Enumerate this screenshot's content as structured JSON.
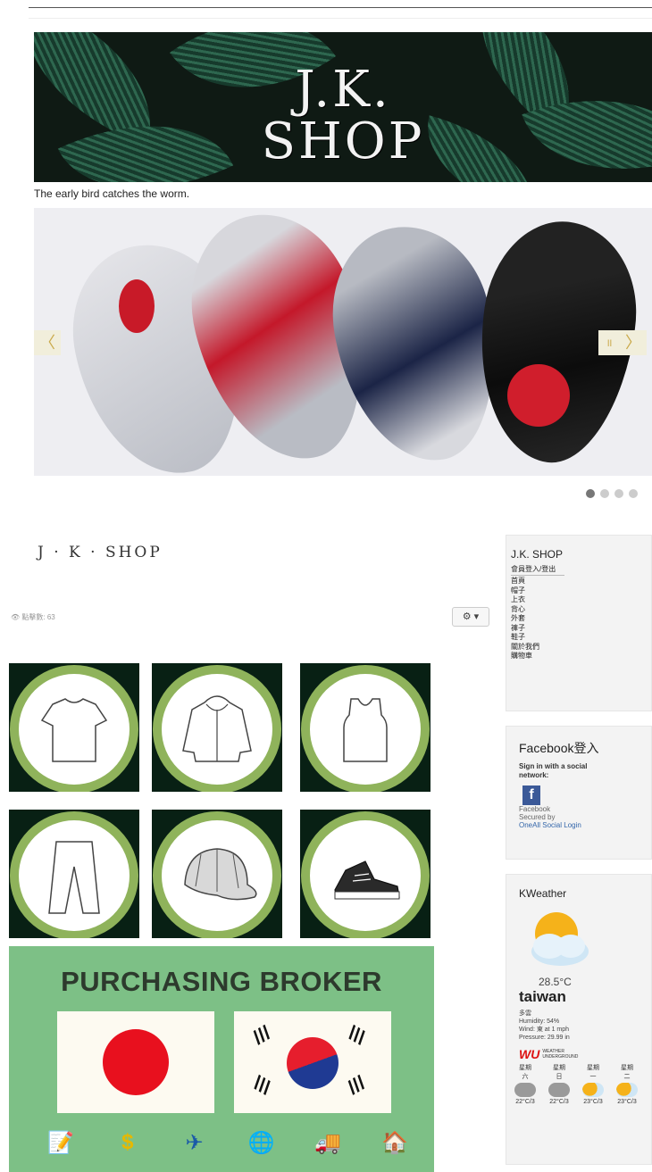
{
  "banner": {
    "title_line1": "J.K.",
    "title_line2": "SHOP"
  },
  "tagline": "The early bird catches the worm.",
  "slider": {
    "prev_label": "〈",
    "pause_label": "॥",
    "next_label": "〉",
    "slide_count": 4,
    "active_slide": 1
  },
  "site": {
    "name": "J · K · SHOP",
    "hits": "點擊數: 63",
    "gear_label": "⚙ ▾"
  },
  "categories": [
    {
      "name": "T-shirt",
      "icon": "tshirt-icon"
    },
    {
      "name": "Hoodie",
      "icon": "hoodie-icon"
    },
    {
      "name": "Vest",
      "icon": "vest-icon"
    },
    {
      "name": "Pants",
      "icon": "pants-icon"
    },
    {
      "name": "Hat",
      "icon": "hat-icon"
    },
    {
      "name": "Shoes",
      "icon": "sneaker-icon"
    }
  ],
  "broker": {
    "title": "PURCHASING BROKER",
    "icons": [
      "📝",
      "$",
      "✈",
      "🌐",
      "🚚",
      "🏠"
    ]
  },
  "sidebar": {
    "menu_title": "J.K. SHOP",
    "login": "會員登入/登出",
    "items": [
      "首頁",
      "帽子",
      "上衣",
      "背心",
      "外套",
      "褲子",
      "鞋子",
      "關於我們",
      "購物車"
    ],
    "facebook": {
      "title": "Facebook登入",
      "signin": "Sign in with a social network:",
      "icon_letter": "f",
      "icon_label": "Facebook",
      "secured_by": "Secured by",
      "provider": "OneAll Social Login"
    },
    "weather": {
      "title": "KWeather",
      "temp": "28.5°C",
      "location": "taiwan",
      "condition": "多雲",
      "humidity": "Humidity: 54%",
      "wind": "Wind: 東 at 1 mph",
      "pressure": "Pressure: 29.99 in",
      "wu_logo": "WU",
      "wu_text1": "WEATHER",
      "wu_text2": "UNDERGROUND",
      "forecast": [
        {
          "day1": "星期",
          "day2": "六",
          "temp": "22°C/3"
        },
        {
          "day1": "星期",
          "day2": "日",
          "temp": "22°C/3"
        },
        {
          "day1": "星期",
          "day2": "一",
          "temp": "23°C/3"
        },
        {
          "day1": "星期",
          "day2": "二",
          "temp": "23°C/3"
        }
      ]
    }
  }
}
